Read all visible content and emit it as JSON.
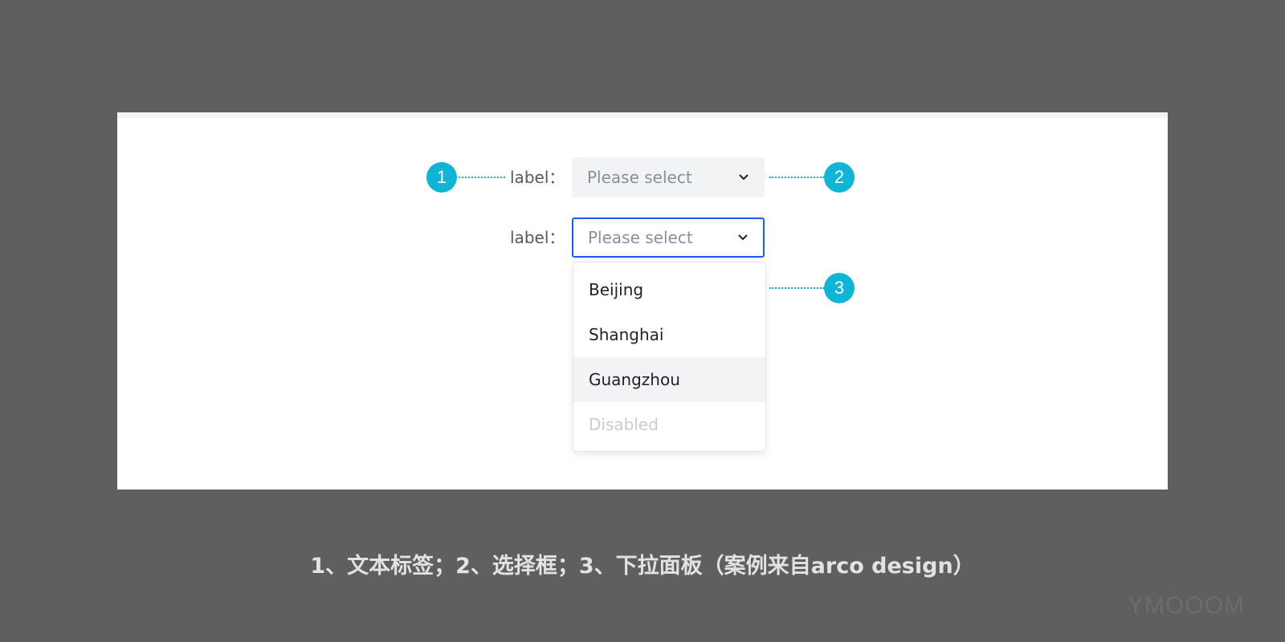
{
  "form": {
    "row1": {
      "label": "label：",
      "placeholder": "Please select"
    },
    "row2": {
      "label": "label：",
      "placeholder": "Please select"
    }
  },
  "dropdown": {
    "options": [
      {
        "label": "Beijing",
        "state": "normal"
      },
      {
        "label": "Shanghai",
        "state": "normal"
      },
      {
        "label": "Guangzhou",
        "state": "hover"
      },
      {
        "label": "Disabled",
        "state": "disabled"
      }
    ]
  },
  "annotations": {
    "1": "1",
    "2": "2",
    "3": "3"
  },
  "caption": "1、文本标签；2、选择框；3、下拉面板（案例来自arco design）",
  "watermark": "YMOOOM",
  "colors": {
    "background": "#5f5f5f",
    "panel": "#ffffff",
    "accent_badge": "#0fb5d6",
    "focus_border": "#165dff",
    "select_fill": "#f2f3f5",
    "hover_fill": "#f2f3f5",
    "disabled_text": "#c9cdd4"
  },
  "icons": {
    "select_arrow": "chevron-down-icon"
  }
}
